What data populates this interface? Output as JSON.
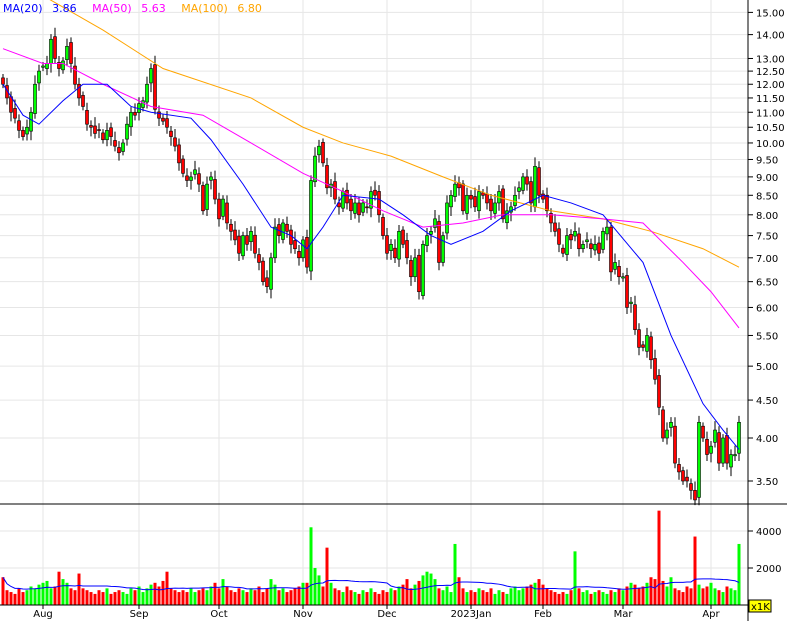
{
  "legend": {
    "ma20_label": "MA(20)",
    "ma20_value": "3.86",
    "ma50_label": "MA(50)",
    "ma50_value": "5.63",
    "ma100_label": "MA(100)",
    "ma100_value": "6.80"
  },
  "colors": {
    "up": "#00ff00",
    "down": "#ff0000",
    "ma20": "#0000ff",
    "ma50": "#ff00ff",
    "ma100": "#ffa500",
    "grid": "#e6e6e6",
    "vol_ma": "#0000ff",
    "unit_badge": "#ffff00"
  },
  "unit_badge": "x1K",
  "chart_data": {
    "type": "candlestick",
    "scale": "log",
    "ylim": [
      3.2,
      15.5
    ],
    "y_ticks": [
      "15.00",
      "14.00",
      "13.00",
      "12.50",
      "12.00",
      "11.50",
      "11.00",
      "10.50",
      "10.00",
      "9.50",
      "9.00",
      "8.50",
      "8.00",
      "7.50",
      "7.00",
      "6.50",
      "6.00",
      "5.50",
      "5.00",
      "4.50",
      "4.00",
      "3.50"
    ],
    "x_labels": [
      {
        "label": "Aug",
        "index": 10
      },
      {
        "label": "Sep",
        "index": 34
      },
      {
        "label": "Oct",
        "index": 54
      },
      {
        "label": "Nov",
        "index": 75
      },
      {
        "label": "Dec",
        "index": 96
      },
      {
        "label": "2023Jan",
        "index": 117
      },
      {
        "label": "Feb",
        "index": 135
      },
      {
        "label": "Mar",
        "index": 155
      },
      {
        "label": "Apr",
        "index": 177
      }
    ],
    "closes": [
      12.0,
      11.5,
      11.0,
      10.8,
      10.4,
      10.2,
      10.5,
      11.0,
      12.0,
      12.5,
      12.7,
      12.8,
      13.8,
      13.0,
      12.6,
      12.9,
      13.5,
      12.8,
      12.0,
      11.5,
      11.2,
      10.6,
      10.5,
      10.3,
      10.4,
      10.1,
      10.4,
      10.2,
      9.9,
      9.7,
      10.0,
      10.6,
      11.0,
      10.9,
      11.3,
      11.4,
      12.0,
      12.6,
      11.1,
      10.8,
      10.7,
      10.5,
      10.2,
      9.9,
      9.4,
      9.1,
      8.9,
      9.0,
      9.2,
      8.8,
      8.1,
      8.8,
      9.0,
      8.4,
      7.9,
      8.4,
      7.8,
      7.6,
      7.4,
      7.1,
      7.5,
      7.3,
      7.6,
      7.1,
      6.9,
      6.5,
      6.4,
      7.0,
      7.7,
      7.5,
      7.8,
      7.6,
      7.3,
      7.2,
      7.0,
      7.4,
      6.8,
      8.9,
      9.6,
      9.9,
      9.4,
      8.7,
      8.8,
      8.4,
      8.2,
      8.6,
      8.3,
      8.1,
      8.3,
      8.0,
      8.3,
      8.2,
      8.6,
      8.5,
      8.0,
      7.5,
      7.1,
      7.3,
      7.0,
      7.6,
      7.3,
      7.0,
      6.6,
      7.0,
      6.3,
      7.3,
      7.5,
      7.6,
      7.9,
      6.9,
      7.5,
      8.3,
      8.5,
      8.8,
      8.7,
      8.1,
      8.5,
      8.4,
      8.2,
      8.6,
      8.5,
      8.3,
      8.1,
      8.3,
      8.6,
      7.9,
      8.1,
      8.2,
      8.5,
      8.7,
      9.0,
      8.8,
      8.3,
      9.3,
      8.5,
      8.4,
      8.1,
      7.8,
      7.6,
      7.3,
      7.1,
      7.5,
      7.4,
      7.6,
      7.2,
      7.3,
      7.4,
      7.2,
      7.3,
      7.1,
      7.6,
      7.7,
      6.7,
      6.9,
      6.6,
      6.6,
      6.0,
      6.1,
      5.6,
      5.3,
      5.3,
      5.5,
      5.1,
      4.8,
      4.4,
      4.0,
      4.1,
      4.2,
      3.7,
      3.6,
      3.5,
      3.5,
      3.4,
      3.3,
      4.2,
      4.0,
      3.8,
      3.9,
      4.1,
      3.7,
      4.0,
      3.7,
      3.8,
      3.8,
      4.2
    ],
    "volume_ticks": [
      "4000",
      "2000"
    ],
    "volumes": [
      1500,
      800,
      700,
      600,
      900,
      700,
      800,
      1000,
      900,
      1100,
      1200,
      1300,
      900,
      1000,
      1800,
      1400,
      1200,
      900,
      800,
      1700,
      900,
      800,
      700,
      600,
      800,
      700,
      900,
      600,
      700,
      800,
      700,
      600,
      900,
      800,
      1000,
      700,
      900,
      1100,
      1200,
      1000,
      1300,
      1800,
      900,
      800,
      700,
      800,
      700,
      900,
      700,
      800,
      900,
      800,
      1000,
      1200,
      900,
      1400,
      1000,
      800,
      700,
      900,
      800,
      700,
      900,
      800,
      1000,
      700,
      900,
      1400,
      1100,
      800,
      900,
      700,
      800,
      900,
      1000,
      1200,
      1200,
      4200,
      2000,
      1600,
      1000,
      3100,
      1200,
      900,
      800,
      700,
      1000,
      800,
      700,
      600,
      800,
      700,
      900,
      700,
      600,
      800,
      700,
      900,
      800,
      1000,
      1100,
      1400,
      900,
      1100,
      1300,
      1600,
      1800,
      1700,
      1400,
      900,
      800,
      1000,
      700,
      3300,
      1500,
      900,
      700,
      800,
      700,
      900,
      800,
      700,
      900,
      600,
      800,
      700,
      600,
      900,
      1000,
      800,
      900,
      1000,
      1100,
      1200,
      1400,
      1100,
      900,
      800,
      700,
      600,
      700,
      600,
      800,
      2900,
      900,
      700,
      800,
      600,
      700,
      800,
      700,
      600,
      800,
      700,
      900,
      800,
      1000,
      1200,
      1100,
      900,
      1000,
      1200,
      1500,
      1400,
      5100,
      1300,
      1000,
      1500,
      900,
      800,
      700,
      1000,
      900,
      3700,
      1100,
      900,
      1000,
      1200,
      900,
      800,
      700,
      1000,
      900,
      800,
      3300
    ],
    "ma_series": [
      {
        "name": "MA(100)",
        "points": [
          [
            0,
            16.5
          ],
          [
            10,
            15.8
          ],
          [
            25,
            14.2
          ],
          [
            40,
            12.6
          ],
          [
            62,
            11.5
          ],
          [
            75,
            10.5
          ],
          [
            85,
            10.0
          ],
          [
            97,
            9.6
          ],
          [
            110,
            9.0
          ],
          [
            122,
            8.5
          ],
          [
            137,
            8.1
          ],
          [
            150,
            7.9
          ],
          [
            162,
            7.6
          ],
          [
            175,
            7.2
          ],
          [
            184,
            6.8
          ]
        ]
      },
      {
        "name": "MA(50)",
        "points": [
          [
            0,
            13.4
          ],
          [
            10,
            12.8
          ],
          [
            15,
            12.8
          ],
          [
            25,
            12.0
          ],
          [
            37,
            11.2
          ],
          [
            50,
            10.9
          ],
          [
            62,
            10.0
          ],
          [
            75,
            9.1
          ],
          [
            85,
            8.6
          ],
          [
            95,
            8.1
          ],
          [
            105,
            7.7
          ],
          [
            115,
            7.8
          ],
          [
            125,
            8.0
          ],
          [
            137,
            8.0
          ],
          [
            150,
            7.9
          ],
          [
            160,
            7.8
          ],
          [
            170,
            6.9
          ],
          [
            177,
            6.3
          ],
          [
            184,
            5.63
          ]
        ]
      },
      {
        "name": "MA(20)",
        "points": [
          [
            0,
            12.0
          ],
          [
            5,
            10.9
          ],
          [
            9,
            10.6
          ],
          [
            15,
            11.4
          ],
          [
            20,
            12.0
          ],
          [
            26,
            12.0
          ],
          [
            32,
            11.2
          ],
          [
            37,
            11.0
          ],
          [
            47,
            10.8
          ],
          [
            52,
            10.1
          ],
          [
            60,
            8.8
          ],
          [
            67,
            7.7
          ],
          [
            72,
            7.5
          ],
          [
            76,
            7.2
          ],
          [
            80,
            7.7
          ],
          [
            85,
            8.5
          ],
          [
            94,
            8.4
          ],
          [
            100,
            8.0
          ],
          [
            107,
            7.5
          ],
          [
            112,
            7.3
          ],
          [
            120,
            7.6
          ],
          [
            127,
            8.1
          ],
          [
            135,
            8.5
          ],
          [
            142,
            8.3
          ],
          [
            150,
            8.0
          ],
          [
            160,
            6.9
          ],
          [
            167,
            5.5
          ],
          [
            175,
            4.45
          ],
          [
            180,
            4.1
          ],
          [
            184,
            3.86
          ]
        ]
      }
    ]
  }
}
